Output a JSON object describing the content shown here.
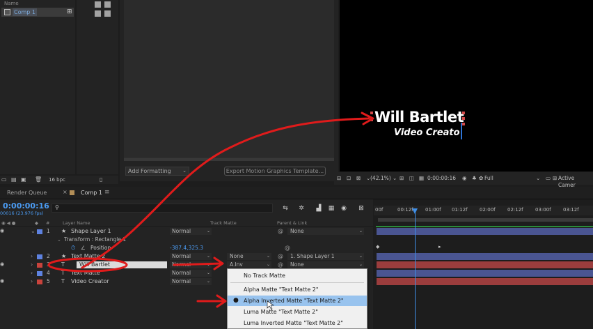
{
  "project": {
    "header": "Name",
    "item_name": "Comp 1",
    "bpc": "16 bpc"
  },
  "egp": {
    "add_formatting": "Add Formatting",
    "export_button": "Export Motion Graphics Template..."
  },
  "viewer": {
    "title_text": "Will Bartlet",
    "subtitle_text": "Video Creato",
    "zoom": "(42.1%)",
    "timecode": "0:00:00:16",
    "resolution": "Full",
    "camera": "Active Camer"
  },
  "tabs": {
    "render_queue": "Render Queue",
    "comp": "Comp 1"
  },
  "timeline": {
    "current_time": "0:00:00:16",
    "fps": "00016 (23.976 fps)",
    "columns": {
      "layer_name": "Layer Name",
      "track_matte": "Track Matte",
      "parent": "Parent & Link"
    },
    "property_group": "Transform : Rectangle 1",
    "property_name": "Position",
    "property_value": "-387.4,325.3",
    "layers": [
      {
        "num": "1",
        "name": "Shape Layer 1",
        "type": "★",
        "mode": "Normal",
        "matte": "",
        "parent": "None",
        "color": "#5e82e0"
      },
      {
        "num": "2",
        "name": "Text Matte 2",
        "type": "★",
        "mode": "Normal",
        "matte": "None",
        "parent": "1. Shape Layer 1",
        "color": "#5e82e0"
      },
      {
        "num": "3",
        "name": "Will Bartlet",
        "type": "T",
        "mode": "Normal",
        "matte": "A.Inv",
        "parent": "None",
        "color": "#c9433c"
      },
      {
        "num": "4",
        "name": "Text Matte",
        "type": "T",
        "mode": "Normal",
        "matte": "",
        "parent": "",
        "color": "#5e82e0"
      },
      {
        "num": "5",
        "name": "Video Creator",
        "type": "T",
        "mode": "Normal",
        "matte": "",
        "parent": "",
        "color": "#c9433c"
      }
    ],
    "ruler": [
      "00f",
      "00:12f",
      "01:00f",
      "01:12f",
      "02:00f",
      "02:12f",
      "03:00f",
      "03:12f"
    ]
  },
  "dropdown": {
    "options": [
      "No Track Matte",
      "Alpha Matte \"Text Matte 2\"",
      "Alpha Inverted Matte \"Text Matte 2\"",
      "Luma Matte \"Text Matte 2\"",
      "Luma Inverted Matte \"Text Matte 2\""
    ],
    "selected_index": 2
  },
  "colors": {
    "accent_blue": "#4b9bf2",
    "annotation_red": "#e01b1b",
    "track_blue": "#4a5592",
    "track_red": "#9b3d3d"
  }
}
